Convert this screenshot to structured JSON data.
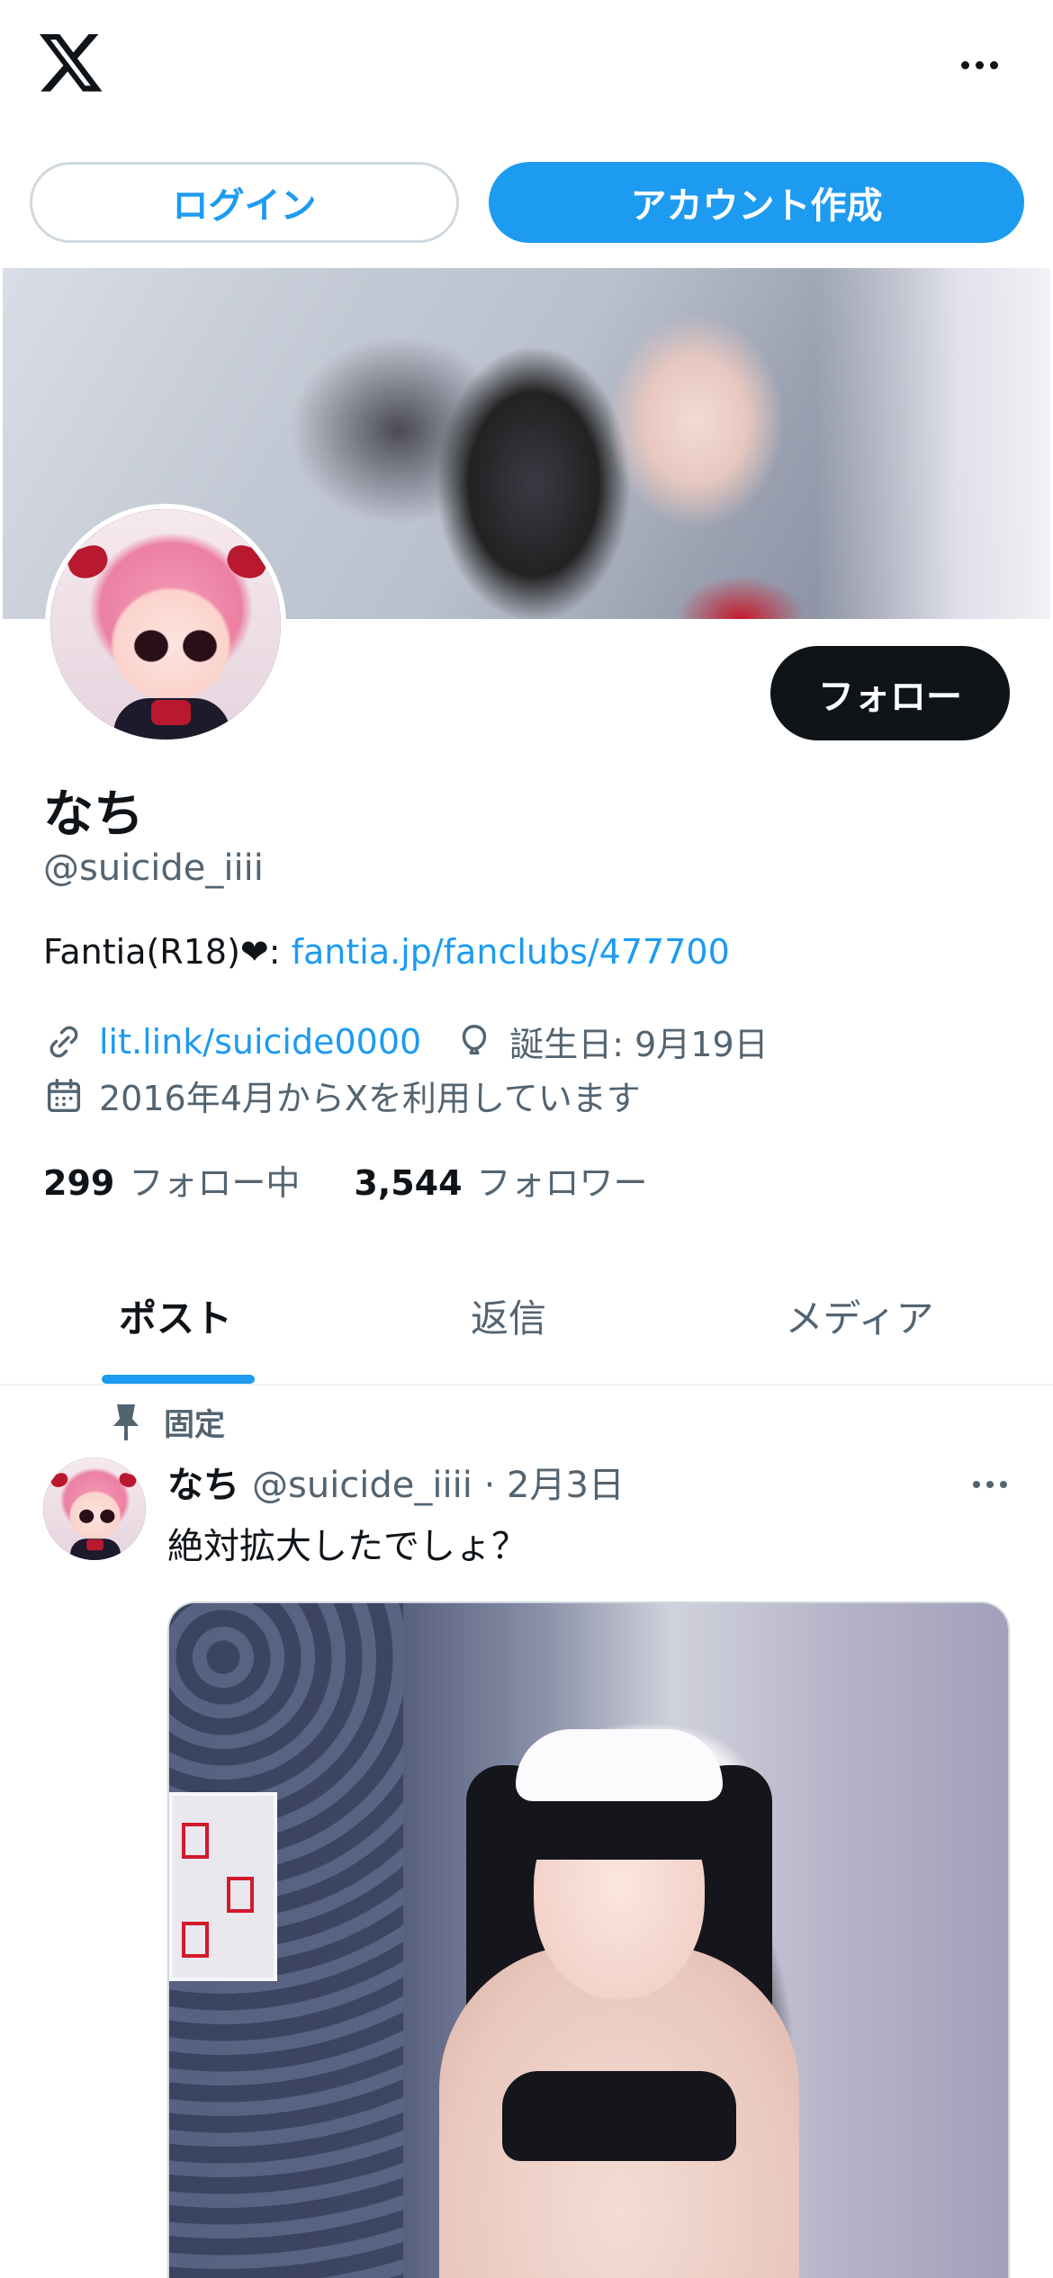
{
  "topbar": {
    "logo": "x-logo",
    "more": "more-icon"
  },
  "auth": {
    "login_label": "ログイン",
    "signup_label": "アカウント作成"
  },
  "profile": {
    "follow_label": "フォロー",
    "name": "なち",
    "handle": "@suicide_iiii",
    "bio_prefix": "Fantia(R18)❤︎: ",
    "bio_link": "fantia.jp/fanclubs/477700",
    "website": "lit.link/suicide0000",
    "birthday": "誕生日: 9月19日",
    "joined": "2016年4月からXを利用しています",
    "following_count": "299",
    "following_label": "フォロー中",
    "followers_count": "3,544",
    "followers_label": "フォロワー"
  },
  "tabs": [
    {
      "label": "ポスト",
      "active": true
    },
    {
      "label": "返信",
      "active": false
    },
    {
      "label": "メディア",
      "active": false
    }
  ],
  "post": {
    "pinned_label": "固定",
    "author_name": "なち",
    "author_handle_date": "@suicide_iiii · 2月3日",
    "text": "絶対拡大したでしょ？"
  },
  "colors": {
    "accent": "#1d9bf0",
    "text": "#0f1419",
    "secondary": "#536471"
  }
}
